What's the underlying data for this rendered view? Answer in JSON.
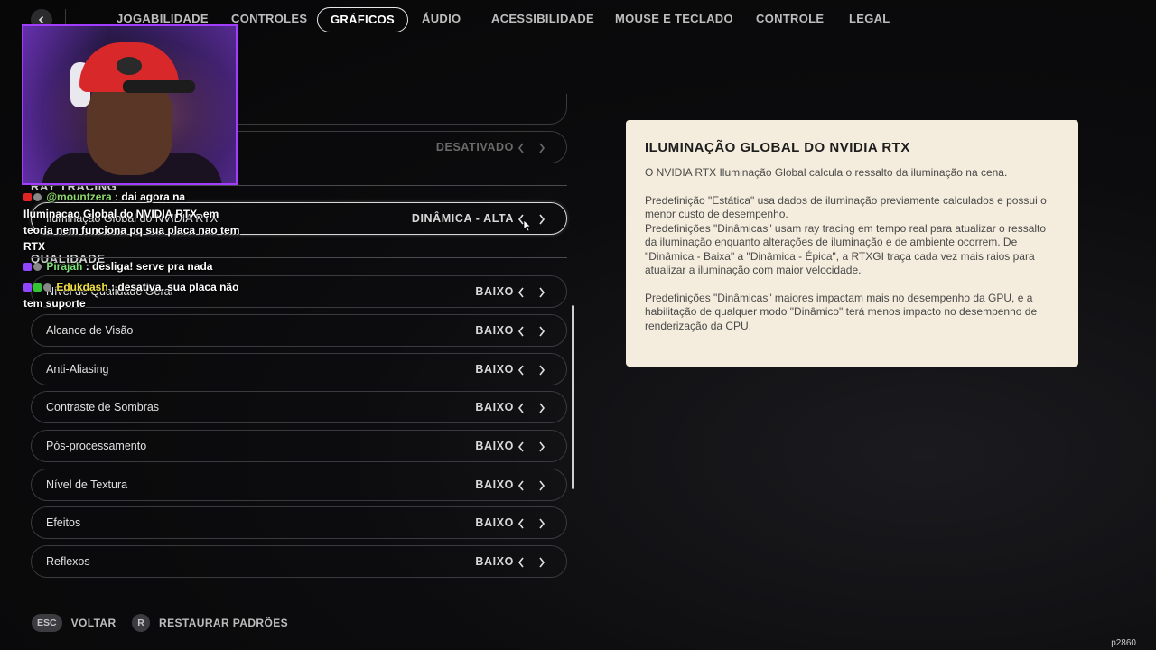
{
  "nav": {
    "tabs": [
      {
        "label": "JOGABILIDADE"
      },
      {
        "label": "CONTROLES"
      },
      {
        "label": "GRÁFICOS"
      },
      {
        "label": "ÁUDIO"
      },
      {
        "label": "ACESSIBILIDADE"
      },
      {
        "label": "MOUSE E TECLADO"
      },
      {
        "label": "CONTROLE"
      },
      {
        "label": "LEGAL"
      }
    ],
    "active_tab": "GRÁFICOS"
  },
  "settings": {
    "partial_row_value": "DESATIVADO",
    "ray_tracing_title": "RAY TRACING",
    "ray_tracing_row": {
      "label": "Iluminação Global do NVIDIA RTX",
      "value": "DINÂMICA - ALTA"
    },
    "quality_title": "QUALIDADE",
    "quality_rows": [
      {
        "label": "Nível de Qualidade Geral",
        "value": "BAIXO"
      },
      {
        "label": "Alcance de Visão",
        "value": "BAIXO"
      },
      {
        "label": "Anti-Aliasing",
        "value": "BAIXO"
      },
      {
        "label": "Contraste de Sombras",
        "value": "BAIXO"
      },
      {
        "label": "Pós-processamento",
        "value": "BAIXO"
      },
      {
        "label": "Nível de Textura",
        "value": "BAIXO"
      },
      {
        "label": "Efeitos",
        "value": "BAIXO"
      },
      {
        "label": "Reflexos",
        "value": "BAIXO"
      }
    ]
  },
  "info_panel": {
    "title": "ILUMINAÇÃO GLOBAL DO NVIDIA RTX",
    "p1": "O NVIDIA RTX Iluminação Global calcula o ressalto da iluminação na cena.",
    "p2": "Predefinição \"Estática\" usa dados de iluminação previamente calculados e possui o menor custo de desempenho.",
    "p3": "Predefinições \"Dinâmicas\" usam ray tracing em tempo real para atualizar o ressalto da iluminação enquanto alterações de iluminação e de ambiente ocorrem. De \"Dinâmica - Baixa\" a \"Dinâmica - Épica\", a RTXGI traça cada vez mais raios para atualizar a iluminação com maior velocidade.",
    "p4": "Predefinições \"Dinâmicas\" maiores impactam mais no desempenho da GPU, e a habilitação de qualquer modo \"Dinâmico\" terá menos impacto no desempenho de renderização da CPU."
  },
  "footer": {
    "back_key": "ESC",
    "back_label": "VOLTAR",
    "restore_key": "R",
    "restore_label": "RESTAURAR PADRÕES",
    "build": "p2860"
  },
  "chat": [
    {
      "user": "@mountzera",
      "text": ": dai agora na"
    },
    {
      "text": "Iluminacao Global do NVIDIA RTX, em"
    },
    {
      "text": "teoria nem funciona pq sua placa nao tem"
    },
    {
      "text": "RTX"
    },
    {
      "user": "Pirajah",
      "text": ": desliga! serve pra nada"
    },
    {
      "user": "Edukdash",
      "text": ": desativa, sua placa não"
    },
    {
      "text": "tem suporte"
    }
  ],
  "colors": {
    "accent_webcam": "#a23cff",
    "panel_bg": "#f4ecdc"
  }
}
